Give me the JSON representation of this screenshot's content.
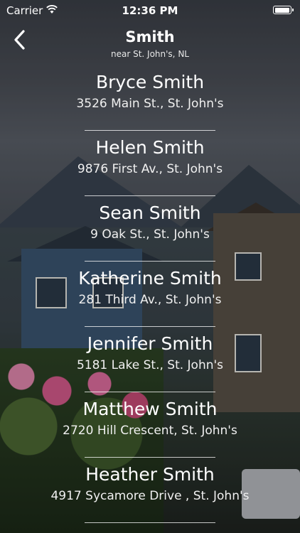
{
  "status_bar": {
    "carrier": "Carrier",
    "time": "12:36 PM",
    "battery_level": 0.9,
    "icons": [
      "wifi-icon",
      "battery-icon"
    ]
  },
  "nav": {
    "title": "Smith",
    "subtitle": "near St. John's, NL",
    "back_icon": "chevron-left-icon"
  },
  "results": [
    {
      "name": "Bryce Smith",
      "address": "3526 Main St., St. John's"
    },
    {
      "name": "Helen Smith",
      "address": "9876 First Av., St. John's"
    },
    {
      "name": "Sean Smith",
      "address": "9 Oak St., St. John's"
    },
    {
      "name": "Katherine Smith",
      "address": "281 Third Av., St. John's"
    },
    {
      "name": "Jennifer Smith",
      "address": "5181 Lake St., St. John's"
    },
    {
      "name": "Matthew Smith",
      "address": "2720 Hill Crescent, St. John's"
    },
    {
      "name": "Heather Smith",
      "address": "4917 Sycamore Drive , St. John's"
    }
  ],
  "colors": {
    "text": "#ffffff",
    "separator": "#ffffff"
  }
}
